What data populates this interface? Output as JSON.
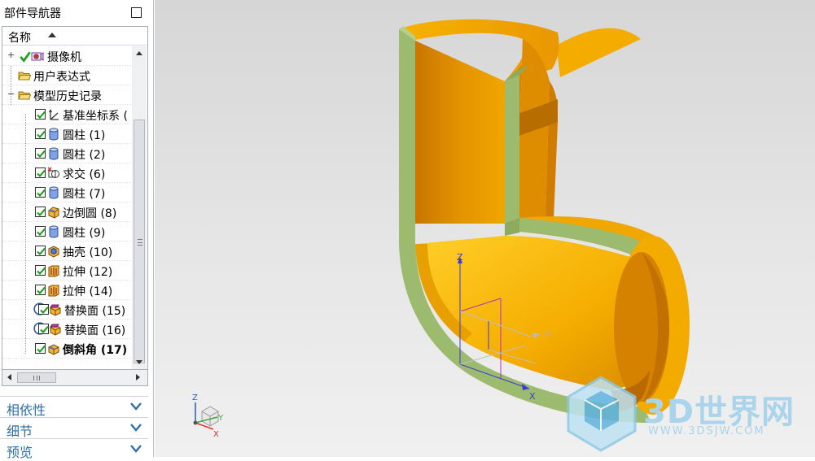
{
  "navigator": {
    "title": "部件导航器",
    "column_header": "名称",
    "items": [
      {
        "label": "摄像机",
        "icon": "camera-icon",
        "check": "green-tick",
        "bold": false
      },
      {
        "label": "用户表达式",
        "icon": "folder-icon",
        "check": "none",
        "bold": false
      },
      {
        "label": "模型历史记录",
        "icon": "folder-icon",
        "check": "none",
        "bold": false
      },
      {
        "label": "基准坐标系 (",
        "icon": "datum-csys-icon",
        "check": "checked",
        "bold": false
      },
      {
        "label": "圆柱 (1)",
        "icon": "cylinder-icon",
        "check": "checked",
        "bold": false
      },
      {
        "label": "圆柱 (2)",
        "icon": "cylinder-icon",
        "check": "checked",
        "bold": false
      },
      {
        "label": "求交 (6)",
        "icon": "intersect-icon",
        "check": "checked",
        "bold": false
      },
      {
        "label": "圆柱 (7)",
        "icon": "cylinder-icon",
        "check": "checked",
        "bold": false
      },
      {
        "label": "边倒圆 (8)",
        "icon": "edge-blend-icon",
        "check": "checked",
        "bold": false
      },
      {
        "label": "圆柱 (9)",
        "icon": "cylinder-icon",
        "check": "checked",
        "bold": false
      },
      {
        "label": "抽壳 (10)",
        "icon": "shell-icon",
        "check": "checked",
        "bold": false
      },
      {
        "label": "拉伸 (12)",
        "icon": "extrude-icon",
        "check": "checked",
        "bold": false
      },
      {
        "label": "拉伸 (14)",
        "icon": "extrude-icon",
        "check": "checked",
        "bold": false
      },
      {
        "label": "替换面 (15)",
        "icon": "replace-face-icon",
        "check": "info",
        "bold": false
      },
      {
        "label": "替换面 (16)",
        "icon": "replace-face-icon",
        "check": "info",
        "bold": false
      },
      {
        "label": "倒斜角 (17)",
        "icon": "chamfer-icon",
        "check": "checked",
        "bold": true
      }
    ],
    "sections": [
      {
        "label": "相依性"
      },
      {
        "label": "细节"
      },
      {
        "label": "预览"
      }
    ]
  },
  "viewport": {
    "csys_axis_labels": {
      "x": "X",
      "y": "Y",
      "z": "Z"
    },
    "triad_axis_labels": {
      "x": "X",
      "y": "Y",
      "z": "Z"
    },
    "watermark": {
      "text": "3D世界网",
      "url": "WWW.3DSJW.COM"
    },
    "colors": {
      "solid": "#e69a00",
      "section": "#9dbb6e",
      "background": "#dcdcdc"
    }
  }
}
